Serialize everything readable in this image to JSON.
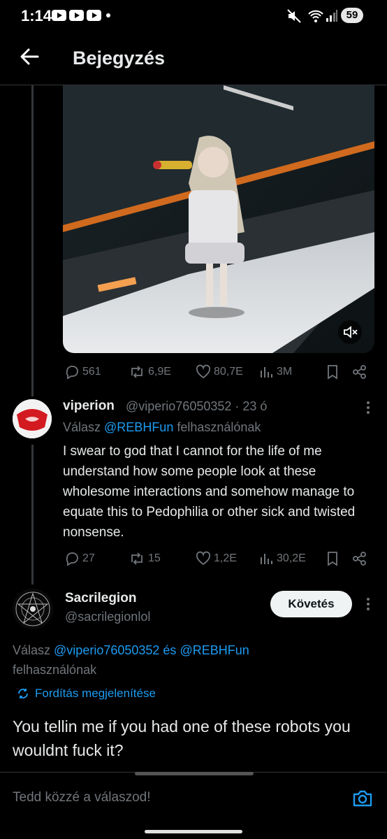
{
  "status_bar": {
    "time": "1:14",
    "battery": "59"
  },
  "header": {
    "title": "Bejegyzés"
  },
  "main_post": {
    "stats": {
      "replies": "561",
      "reposts": "6,9E",
      "likes": "80,7E",
      "views": "3M"
    }
  },
  "reply1": {
    "name": "viperion",
    "handle_time": "@viperio76050352 · 23 ó",
    "reply_prefix": "Válasz ",
    "reply_to": "@REBHFun",
    "reply_suffix": " felhasználónak",
    "text": "I swear to god that I cannot for the life of me understand how some people look at these wholesome interactions and somehow manage to equate this to Pedophilia or other sick and twisted nonsense.",
    "stats": {
      "replies": "27",
      "reposts": "15",
      "likes": "1,2E",
      "views": "30,2E"
    }
  },
  "reply2": {
    "name": "Sacrilegion",
    "handle": "@sacrilegionlol",
    "follow_label": "Követés",
    "reply_prefix": "Válasz ",
    "reply_to_1": "@viperio76050352",
    "reply_and": " és ",
    "reply_to_2": "@REBHFun",
    "reply_suffix": "felhasználónak",
    "translate_label": "Fordítás megjelenítése",
    "text": "You tellin me if you had one of these robots you wouldnt fuck it?"
  },
  "reply_box": {
    "placeholder": "Tedd közzé a válaszod!"
  }
}
